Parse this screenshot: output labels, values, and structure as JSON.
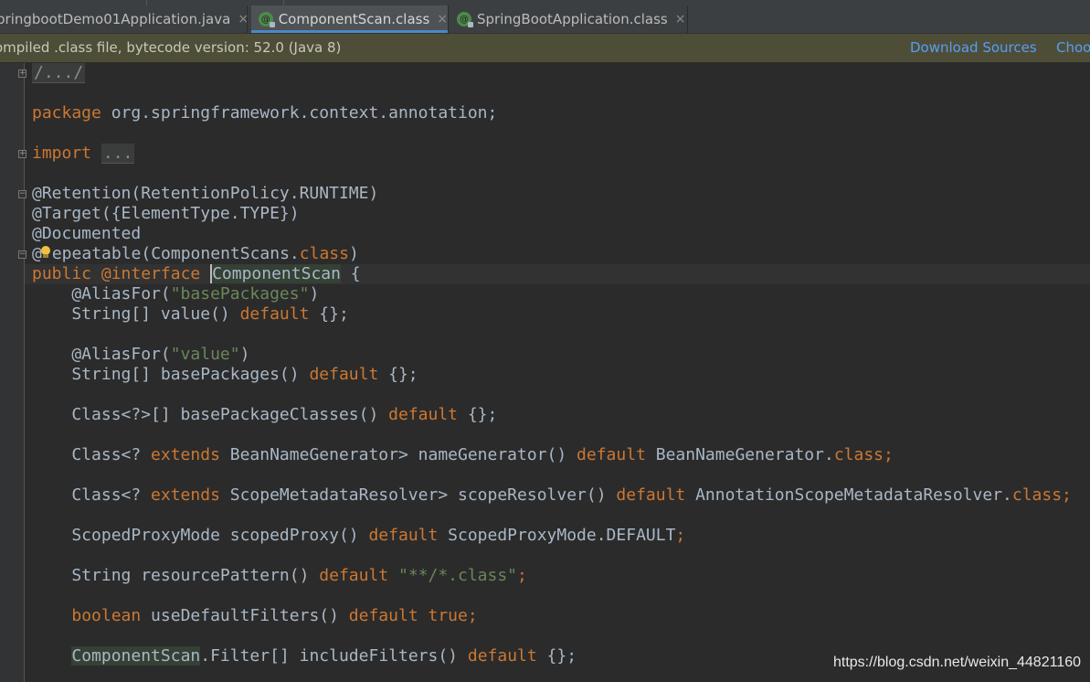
{
  "tabs": [
    {
      "label": "pringbootDemo01Application.java",
      "close": "×",
      "active": false
    },
    {
      "label": "ComponentScan.class",
      "close": "×",
      "active": true
    },
    {
      "label": "SpringBootApplication.class",
      "close": "×",
      "active": false
    }
  ],
  "banner": {
    "message": "ompiled .class file, bytecode version: 52.0 (Java 8)",
    "download_sources": "Download Sources",
    "choose_sources": "Choo"
  },
  "code": {
    "header_fold": "/.../",
    "package_kw": "package",
    "package_name": " org.springframework.context.annotation;",
    "import_kw": "import",
    "import_fold": "...",
    "retention": "@Retention(RetentionPolicy.RUNTIME)",
    "target": "@Target({ElementType.TYPE})",
    "documented": "@Documented",
    "repeatable_prefix": "@",
    "repeatable_rest": "epeatable(ComponentScans.",
    "repeatable_class": "class",
    "repeatable_end": ")",
    "public_kw": "public",
    "interface_kw": " @interface ",
    "class_name": "ComponentScan",
    "open_brace": " {",
    "l1": "    @AliasFor(",
    "l1_str": "\"basePackages\"",
    "l2_type": "    String[] value() ",
    "default_kw": "default",
    "l2_end": " {};",
    "l3_str": "\"value\"",
    "l4_type": "    String[] basePackages() ",
    "l5_type": "    Class<?>[] basePackageClasses() ",
    "l6_pre": "    Class<? ",
    "extends_kw": "extends",
    "l6_mid": " BeanNameGenerator> nameGenerator() ",
    "l6_val": " BeanNameGenerator.",
    "class_kw": "class;",
    "l7_mid": " ScopeMetadataResolver> scopeResolver() ",
    "l7_val": " AnnotationScopeMetadataResolver.",
    "l8_pre": "    ScopedProxyMode scopedProxy() ",
    "l8_val": " ScopedProxyMode.DEFAULT",
    "semi": ";",
    "l9_pre": "    String resourcePattern() ",
    "l9_str": " \"**/*.class\"",
    "boolean_kw": "boolean",
    "l10_mid": " useDefaultFilters() ",
    "true_kw": " true;",
    "l11_rest": ".Filter[] includeFilters() ",
    "close_paren": ")"
  },
  "watermark": "https://blog.csdn.net/weixin_44821160"
}
